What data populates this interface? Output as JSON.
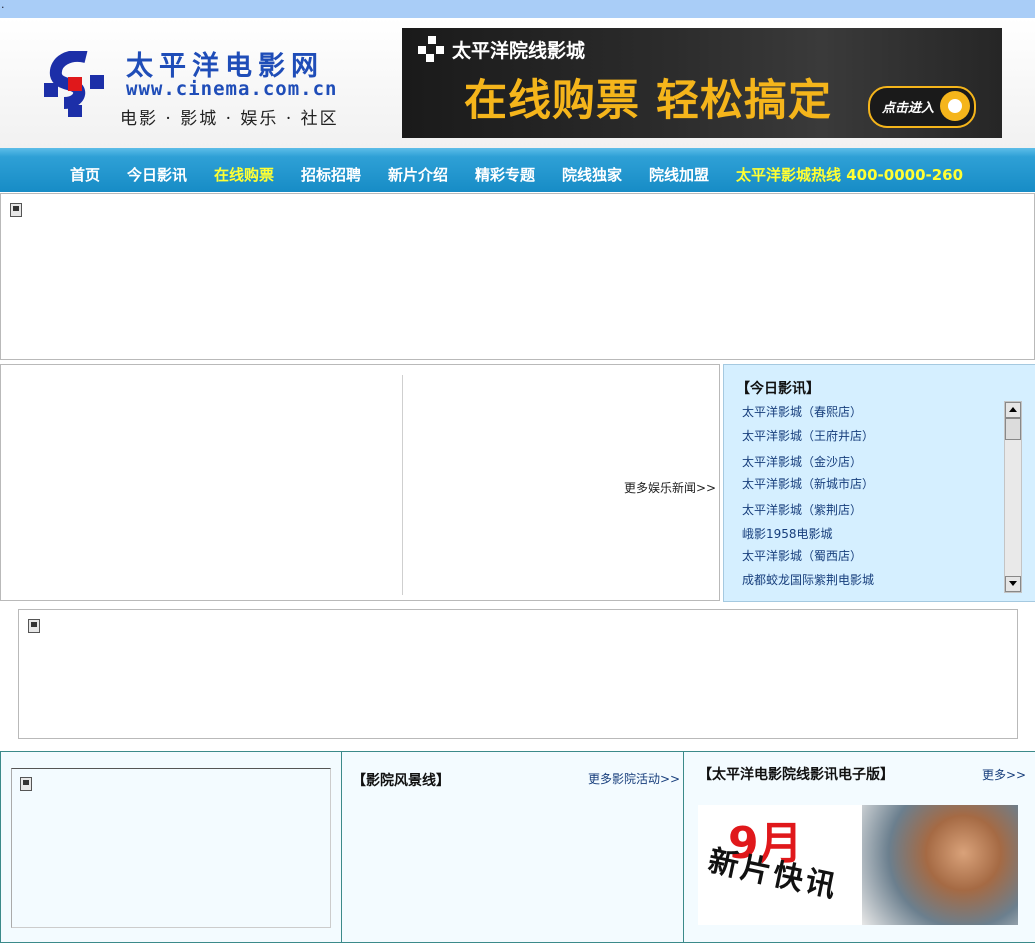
{
  "top_strip": {
    "text": "."
  },
  "header": {
    "site_name": "太平洋电影网",
    "site_url": "www.cinema.com.cn",
    "site_slogan": "电影 · 影城 · 娱乐 · 社区",
    "banner": {
      "brand": "太平洋院线影城",
      "headline": "在线购票 轻松搞定",
      "enter_label": "点击进入"
    }
  },
  "nav": {
    "items": [
      {
        "label": "首页"
      },
      {
        "label": "今日影讯"
      },
      {
        "label": "在线购票"
      },
      {
        "label": "招标招聘"
      },
      {
        "label": "新片介绍"
      },
      {
        "label": "精彩专题"
      },
      {
        "label": "院线独家"
      },
      {
        "label": "院线加盟"
      }
    ],
    "active_item": "在线购票",
    "hotline": "太平洋影城热线  400-0000-260"
  },
  "news_panel": {
    "more_label": "更多娱乐新闻>>"
  },
  "today_showtimes": {
    "title": "【今日影讯】",
    "cinemas": [
      "太平洋影城（春熙店）",
      "太平洋影城（王府井店）",
      "太平洋影城（金沙店）",
      "太平洋影城（新城市店）",
      "太平洋影城（紫荆店）",
      "峨影1958电影城",
      "太平洋影城（蜀西店）",
      "成都蛟龙国际紫荆电影城"
    ]
  },
  "bottom": {
    "scenery": {
      "title": "【影院风景线】",
      "more_label": "更多影院活动>>"
    },
    "epaper": {
      "title": "【太平洋电影院线影讯电子版】",
      "more_label": "更多>>"
    },
    "promo": {
      "month": "9月",
      "caption": "新片快讯"
    }
  },
  "colors": {
    "nav_active": "#ffff33",
    "nav_bg": "#178cc6",
    "link": "#173e7c",
    "accent": "#f5b51b"
  }
}
